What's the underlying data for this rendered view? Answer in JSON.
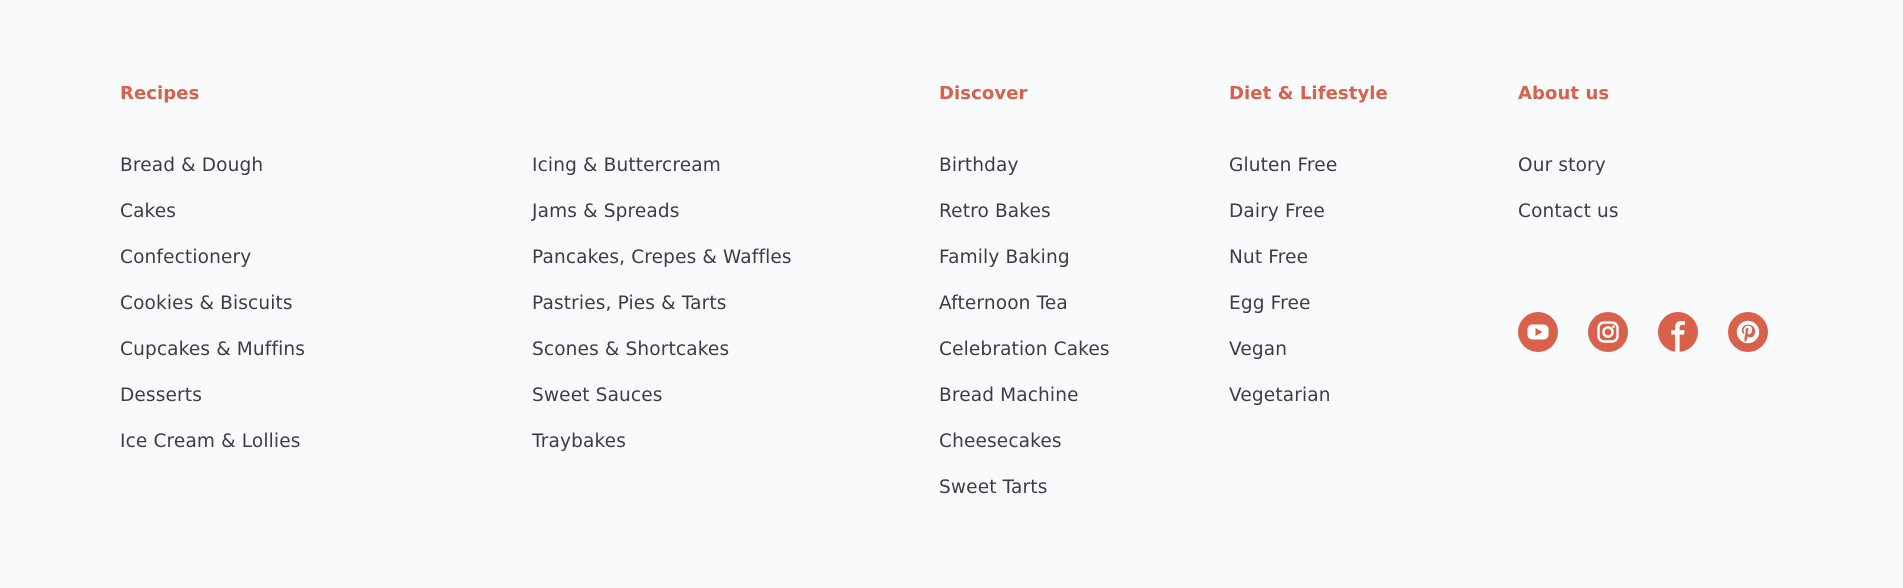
{
  "theme": {
    "accent": "#d9604b",
    "text": "#3c3c46",
    "background": "#f9fafc"
  },
  "recipes": {
    "heading": "Recipes",
    "left_links": [
      "Bread & Dough",
      "Cakes",
      "Confectionery",
      "Cookies & Biscuits",
      "Cupcakes & Muffins",
      "Desserts",
      "Ice Cream & Lollies"
    ],
    "right_links": [
      "Icing & Buttercream",
      "Jams & Spreads",
      "Pancakes, Crepes & Waffles",
      "Pastries, Pies & Tarts",
      "Scones & Shortcakes",
      "Sweet Sauces",
      "Traybakes"
    ]
  },
  "discover": {
    "heading": "Discover",
    "links": [
      "Birthday",
      "Retro Bakes",
      "Family Baking",
      "Afternoon Tea",
      "Celebration Cakes",
      "Bread Machine",
      "Cheesecakes",
      "Sweet Tarts"
    ]
  },
  "diet": {
    "heading": "Diet & Lifestyle",
    "links": [
      "Gluten Free",
      "Dairy Free",
      "Nut Free",
      "Egg Free",
      "Vegan",
      "Vegetarian"
    ]
  },
  "about": {
    "heading": "About us",
    "links": [
      "Our story",
      "Contact us"
    ]
  },
  "social": [
    {
      "icon": "youtube-icon"
    },
    {
      "icon": "instagram-icon"
    },
    {
      "icon": "facebook-icon"
    },
    {
      "icon": "pinterest-icon"
    }
  ]
}
